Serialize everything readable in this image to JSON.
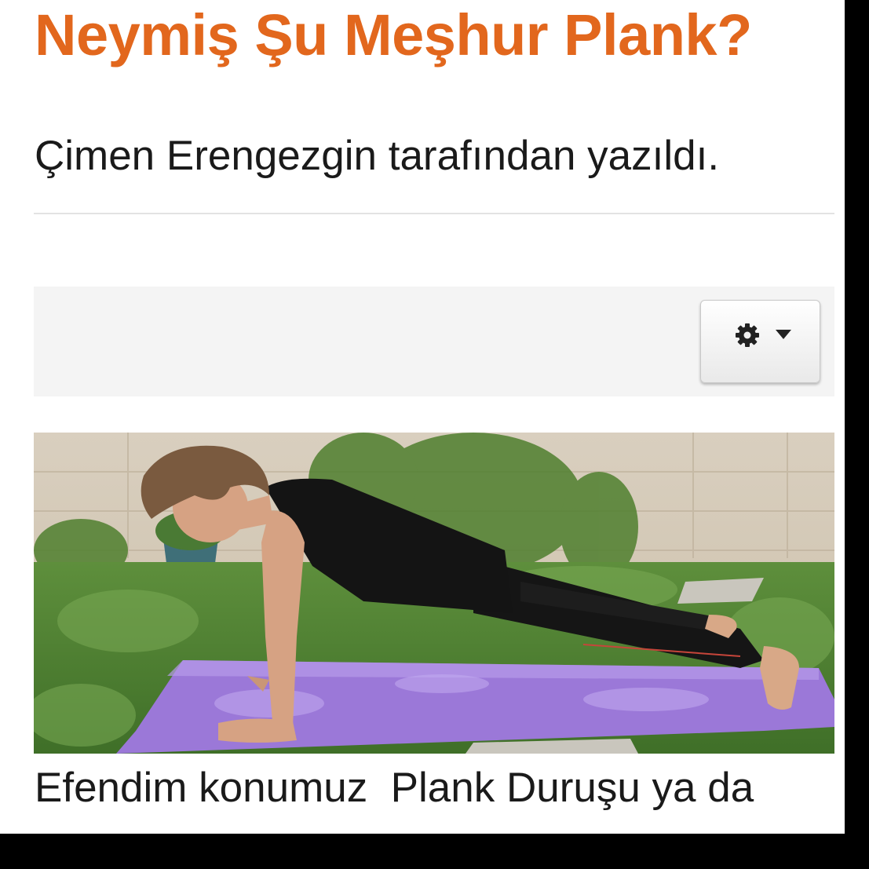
{
  "article": {
    "title": "Neymiş Şu Meşhur Plank?",
    "byline": "Çimen Erengezgin tarafından yazıldı.",
    "intro_text": "Efendim konumuz  Plank Duruşu ya da"
  },
  "toolbar": {
    "tools_button_icon": "gear-icon",
    "tools_button_caret": "chevron-down-icon"
  },
  "colors": {
    "title": "#e2671d",
    "background": "#ffffff",
    "frame": "#000000"
  }
}
